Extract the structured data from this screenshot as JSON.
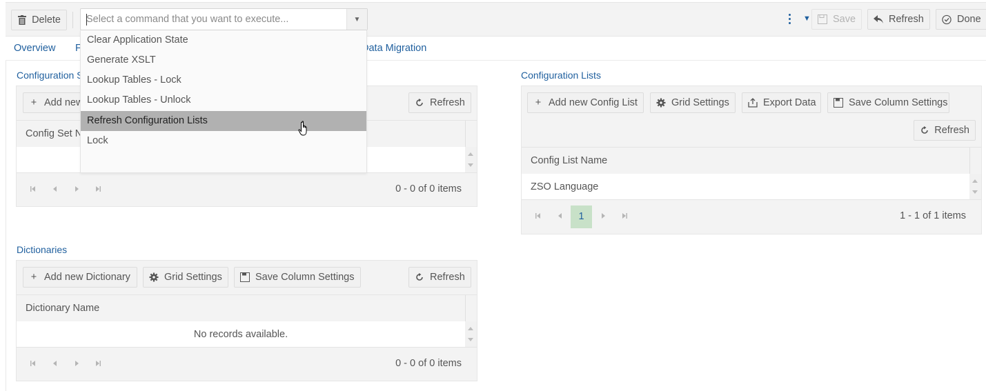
{
  "toolbar": {
    "delete_label": "Delete",
    "command_placeholder": "Select a command that you want to execute...",
    "command_value": "",
    "save_label": "Save",
    "refresh_label": "Refresh",
    "done_label": "Done"
  },
  "command_dropdown": {
    "items": [
      {
        "label": "Clear Application State"
      },
      {
        "label": "Generate XSLT"
      },
      {
        "label": "Lookup Tables - Lock"
      },
      {
        "label": "Lookup Tables - Unlock"
      },
      {
        "label": "Refresh Configuration Lists",
        "hovered": true
      },
      {
        "label": "Lock"
      }
    ]
  },
  "tabs": [
    {
      "label": "Overview"
    },
    {
      "label": "F"
    },
    {
      "label": "Data Migration"
    }
  ],
  "config_sets": {
    "title": "Configuration Sets",
    "add_label": "Add new",
    "refresh_label": "Refresh",
    "column": "Config Set Name",
    "rows": [],
    "pager_info": "0 - 0 of 0 items"
  },
  "config_lists": {
    "title": "Configuration Lists",
    "add_label": "Add new Config List",
    "grid_settings_label": "Grid Settings",
    "export_label": "Export Data",
    "save_columns_label": "Save Column Settings",
    "refresh_label": "Refresh",
    "column": "Config List Name",
    "rows": [
      {
        "name": "ZSO Language"
      }
    ],
    "current_page": "1",
    "pager_info": "1 - 1 of 1 items"
  },
  "dictionaries": {
    "title": "Dictionaries",
    "add_label": "Add new Dictionary",
    "grid_settings_label": "Grid Settings",
    "save_columns_label": "Save Column Settings",
    "refresh_label": "Refresh",
    "column": "Dictionary Name",
    "empty_text": "No records available.",
    "pager_info": "0 - 0 of 0 items"
  },
  "colors": {
    "accent": "#1f5f9e",
    "hover_item": "#b1b1b1",
    "page_active": "#c8e1c8"
  }
}
